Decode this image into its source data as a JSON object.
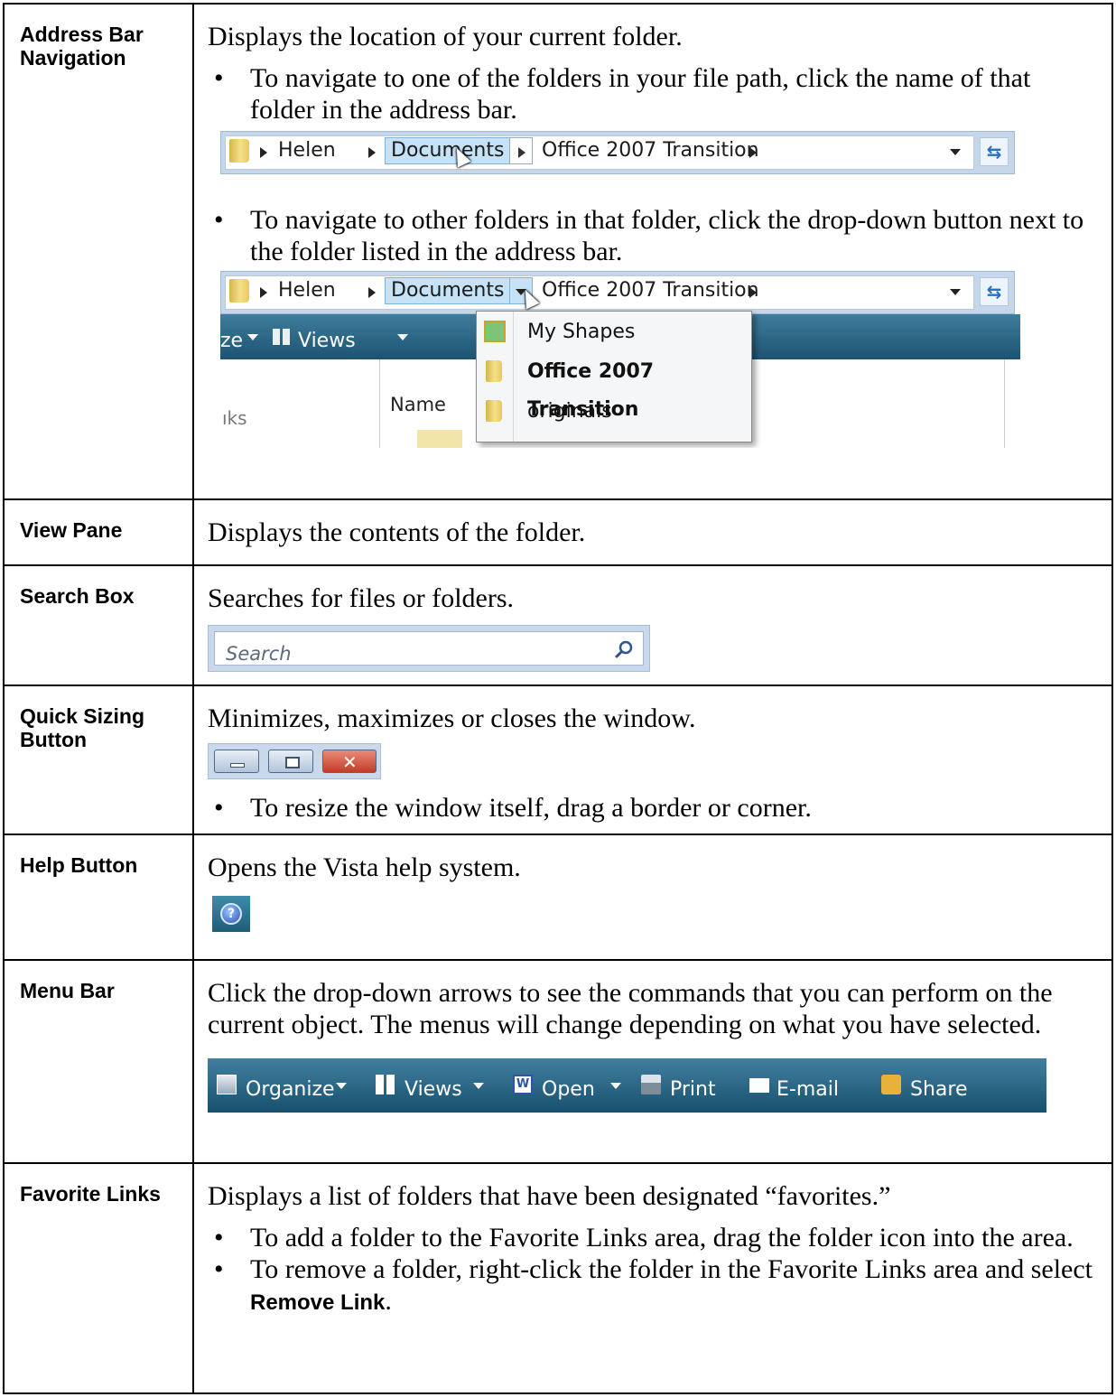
{
  "rows": [
    {
      "term": "Address Bar Navigation",
      "desc": "Displays the location of your current folder.",
      "bullet1": "To navigate to one of the folders in your file path, click the name of that folder in the address bar.",
      "bullet2": "To navigate to other folders in that folder, click the drop-down button next to the folder listed in the address bar."
    },
    {
      "term": "View Pane",
      "desc": "Displays the contents of the folder."
    },
    {
      "term": "Search Box",
      "desc": "Searches for files or folders."
    },
    {
      "term": "Quick Sizing Button",
      "desc": "Minimizes, maximizes or closes the window.",
      "bullet1": "To resize the window itself, drag a border or corner."
    },
    {
      "term": "Help Button",
      "desc": "Opens the Vista help system."
    },
    {
      "term": "Menu Bar",
      "desc": "Click the drop-down arrows to see the commands that you can perform on the current object.  The menus will change depending on what you have selected."
    },
    {
      "term": "Favorite Links",
      "desc": "Displays a list of folders that have been designated “favorites.”",
      "bullet1": "To add a folder to the Favorite Links area, drag the folder icon into the area.",
      "bullet2_pre": "To remove a folder, right-click the folder in the Favorite Links area and select ",
      "bullet2_bold": "Remove Link",
      "bullet2_post": "."
    }
  ],
  "address_bar": {
    "crumbs": [
      "Helen",
      "Documents",
      "Office 2007 Transition"
    ]
  },
  "dropdown_menu": {
    "items": [
      "My Shapes",
      "Office 2007 Transition",
      "originals"
    ]
  },
  "explorer_partial": {
    "toolbar_left": "ze",
    "views": "Views",
    "column_name": "Name",
    "links_partial": "ıks"
  },
  "search": {
    "placeholder": "Search"
  },
  "menu_bar": {
    "items": [
      "Organize",
      "Views",
      "Open",
      "Print",
      "E-mail",
      "Share"
    ]
  },
  "colors": {
    "toolbar": "#1d5372",
    "selected_crumb": "#c6e2f6",
    "close_button": "#c33d24"
  }
}
